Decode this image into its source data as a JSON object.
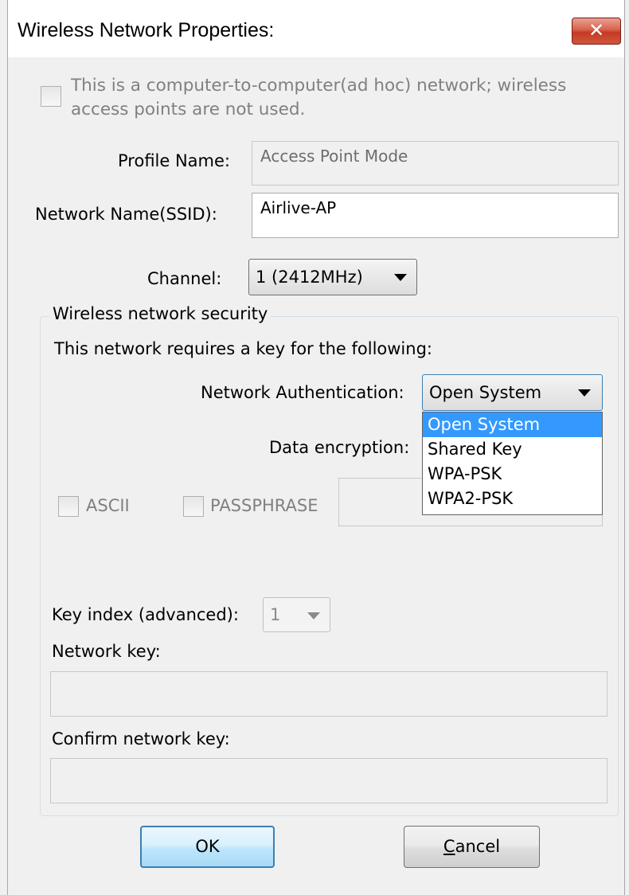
{
  "window": {
    "title": "Wireless Network Properties:",
    "close_glyph": "✕"
  },
  "adhoc": {
    "label_line1": "This is a computer-to-computer(ad hoc) network; wireless",
    "label_line2": "access points are not used.",
    "checked": false
  },
  "profile": {
    "label": "Profile Name:",
    "value": "Access Point Mode"
  },
  "ssid": {
    "label": "Network Name(SSID):",
    "value": "Airlive-AP"
  },
  "channel": {
    "label": "Channel:",
    "value": "1  (2412MHz)"
  },
  "security": {
    "group_title": "Wireless network security",
    "intro": "This network requires a key for the following:",
    "auth_label": "Network Authentication:",
    "auth_value": "Open System",
    "auth_options": [
      "Open System",
      "Shared Key",
      "WPA-PSK",
      "WPA2-PSK"
    ],
    "auth_selected_index": 0,
    "encryption_label": "Data encryption:",
    "ascii_label": "ASCII",
    "passphrase_label": "PASSPHRASE",
    "key_index_label": "Key index (advanced):",
    "key_index_value": "1",
    "network_key_label": "Network key:",
    "confirm_key_label": "Confirm network key:"
  },
  "buttons": {
    "ok": "OK",
    "cancel": "Cancel"
  },
  "colors": {
    "close_button": "#c43a23",
    "selection_highlight": "#3399ff",
    "default_button_border": "#3c7fb1"
  }
}
